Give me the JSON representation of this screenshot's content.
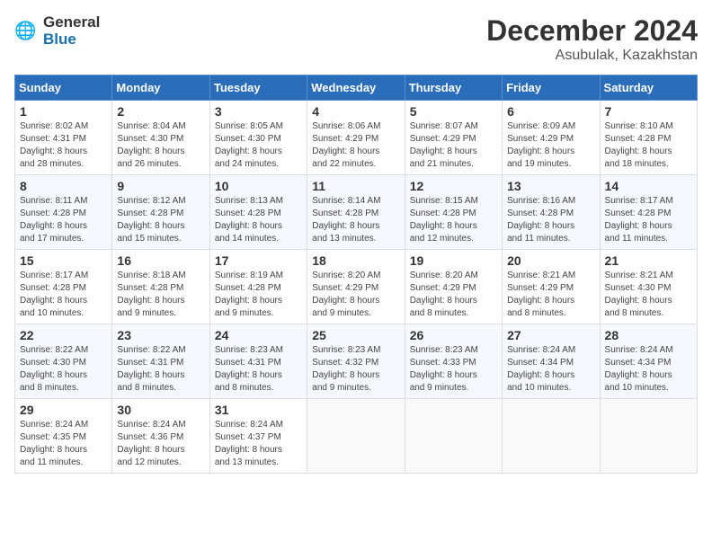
{
  "header": {
    "logo_text_general": "General",
    "logo_text_blue": "Blue",
    "month": "December 2024",
    "location": "Asubulak, Kazakhstan"
  },
  "days_of_week": [
    "Sunday",
    "Monday",
    "Tuesday",
    "Wednesday",
    "Thursday",
    "Friday",
    "Saturday"
  ],
  "weeks": [
    [
      {
        "day": "1",
        "info": "Sunrise: 8:02 AM\nSunset: 4:31 PM\nDaylight: 8 hours\nand 28 minutes."
      },
      {
        "day": "2",
        "info": "Sunrise: 8:04 AM\nSunset: 4:30 PM\nDaylight: 8 hours\nand 26 minutes."
      },
      {
        "day": "3",
        "info": "Sunrise: 8:05 AM\nSunset: 4:30 PM\nDaylight: 8 hours\nand 24 minutes."
      },
      {
        "day": "4",
        "info": "Sunrise: 8:06 AM\nSunset: 4:29 PM\nDaylight: 8 hours\nand 22 minutes."
      },
      {
        "day": "5",
        "info": "Sunrise: 8:07 AM\nSunset: 4:29 PM\nDaylight: 8 hours\nand 21 minutes."
      },
      {
        "day": "6",
        "info": "Sunrise: 8:09 AM\nSunset: 4:29 PM\nDaylight: 8 hours\nand 19 minutes."
      },
      {
        "day": "7",
        "info": "Sunrise: 8:10 AM\nSunset: 4:28 PM\nDaylight: 8 hours\nand 18 minutes."
      }
    ],
    [
      {
        "day": "8",
        "info": "Sunrise: 8:11 AM\nSunset: 4:28 PM\nDaylight: 8 hours\nand 17 minutes."
      },
      {
        "day": "9",
        "info": "Sunrise: 8:12 AM\nSunset: 4:28 PM\nDaylight: 8 hours\nand 15 minutes."
      },
      {
        "day": "10",
        "info": "Sunrise: 8:13 AM\nSunset: 4:28 PM\nDaylight: 8 hours\nand 14 minutes."
      },
      {
        "day": "11",
        "info": "Sunrise: 8:14 AM\nSunset: 4:28 PM\nDaylight: 8 hours\nand 13 minutes."
      },
      {
        "day": "12",
        "info": "Sunrise: 8:15 AM\nSunset: 4:28 PM\nDaylight: 8 hours\nand 12 minutes."
      },
      {
        "day": "13",
        "info": "Sunrise: 8:16 AM\nSunset: 4:28 PM\nDaylight: 8 hours\nand 11 minutes."
      },
      {
        "day": "14",
        "info": "Sunrise: 8:17 AM\nSunset: 4:28 PM\nDaylight: 8 hours\nand 11 minutes."
      }
    ],
    [
      {
        "day": "15",
        "info": "Sunrise: 8:17 AM\nSunset: 4:28 PM\nDaylight: 8 hours\nand 10 minutes."
      },
      {
        "day": "16",
        "info": "Sunrise: 8:18 AM\nSunset: 4:28 PM\nDaylight: 8 hours\nand 9 minutes."
      },
      {
        "day": "17",
        "info": "Sunrise: 8:19 AM\nSunset: 4:28 PM\nDaylight: 8 hours\nand 9 minutes."
      },
      {
        "day": "18",
        "info": "Sunrise: 8:20 AM\nSunset: 4:29 PM\nDaylight: 8 hours\nand 9 minutes."
      },
      {
        "day": "19",
        "info": "Sunrise: 8:20 AM\nSunset: 4:29 PM\nDaylight: 8 hours\nand 8 minutes."
      },
      {
        "day": "20",
        "info": "Sunrise: 8:21 AM\nSunset: 4:29 PM\nDaylight: 8 hours\nand 8 minutes."
      },
      {
        "day": "21",
        "info": "Sunrise: 8:21 AM\nSunset: 4:30 PM\nDaylight: 8 hours\nand 8 minutes."
      }
    ],
    [
      {
        "day": "22",
        "info": "Sunrise: 8:22 AM\nSunset: 4:30 PM\nDaylight: 8 hours\nand 8 minutes."
      },
      {
        "day": "23",
        "info": "Sunrise: 8:22 AM\nSunset: 4:31 PM\nDaylight: 8 hours\nand 8 minutes."
      },
      {
        "day": "24",
        "info": "Sunrise: 8:23 AM\nSunset: 4:31 PM\nDaylight: 8 hours\nand 8 minutes."
      },
      {
        "day": "25",
        "info": "Sunrise: 8:23 AM\nSunset: 4:32 PM\nDaylight: 8 hours\nand 9 minutes."
      },
      {
        "day": "26",
        "info": "Sunrise: 8:23 AM\nSunset: 4:33 PM\nDaylight: 8 hours\nand 9 minutes."
      },
      {
        "day": "27",
        "info": "Sunrise: 8:24 AM\nSunset: 4:34 PM\nDaylight: 8 hours\nand 10 minutes."
      },
      {
        "day": "28",
        "info": "Sunrise: 8:24 AM\nSunset: 4:34 PM\nDaylight: 8 hours\nand 10 minutes."
      }
    ],
    [
      {
        "day": "29",
        "info": "Sunrise: 8:24 AM\nSunset: 4:35 PM\nDaylight: 8 hours\nand 11 minutes."
      },
      {
        "day": "30",
        "info": "Sunrise: 8:24 AM\nSunset: 4:36 PM\nDaylight: 8 hours\nand 12 minutes."
      },
      {
        "day": "31",
        "info": "Sunrise: 8:24 AM\nSunset: 4:37 PM\nDaylight: 8 hours\nand 13 minutes."
      },
      {
        "day": "",
        "info": ""
      },
      {
        "day": "",
        "info": ""
      },
      {
        "day": "",
        "info": ""
      },
      {
        "day": "",
        "info": ""
      }
    ]
  ]
}
